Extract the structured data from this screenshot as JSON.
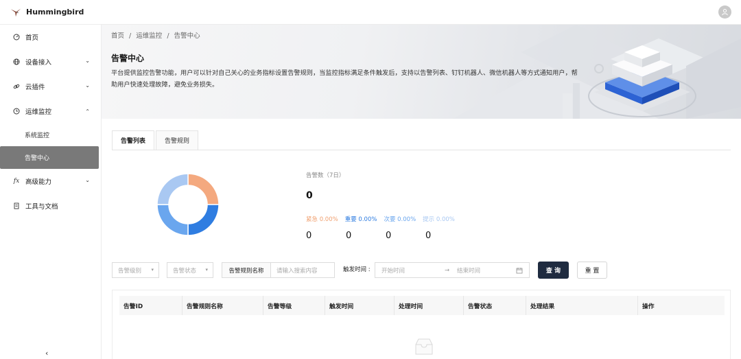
{
  "app": {
    "title": "Hummingbird"
  },
  "sidebar": {
    "items": [
      {
        "label": "首页",
        "icon": "dashboard-icon"
      },
      {
        "label": "设备接入",
        "icon": "globe-icon",
        "expandable": true
      },
      {
        "label": "云插件",
        "icon": "link-icon",
        "expandable": true
      },
      {
        "label": "运维监控",
        "icon": "clock-icon",
        "expanded": true,
        "children": [
          {
            "label": "系统监控"
          },
          {
            "label": "告警中心",
            "active": true
          }
        ]
      },
      {
        "label": "高级能力",
        "icon": "fx-icon",
        "expandable": true
      },
      {
        "label": "工具与文档",
        "icon": "doc-icon"
      }
    ]
  },
  "breadcrumb": [
    "首页",
    "/",
    "运维监控",
    "/",
    "告警中心"
  ],
  "page": {
    "title": "告警中心",
    "description": "平台提供监控告警功能，用户可以针对自己关心的业务指标设置告警规则，当监控指标满足条件触发后，支持以告警列表、钉钉机器人、微信机器人等方式通知用户，帮助用户快速处理故障，避免业务损失。"
  },
  "tabs": [
    {
      "label": "告警列表",
      "active": true
    },
    {
      "label": "告警规则"
    }
  ],
  "stats": {
    "label": "告警数（7日）",
    "total": "0",
    "levels": [
      {
        "name": "紧急 0.00%",
        "color": "#f0a070",
        "count": "0"
      },
      {
        "name": "重要 0.00%",
        "color": "#2f7de1",
        "count": "0"
      },
      {
        "name": "次要 0.00%",
        "color": "#6aa6ee",
        "count": "0"
      },
      {
        "name": "提示 0.00%",
        "color": "#a9c8f2",
        "count": "0"
      }
    ]
  },
  "donut": {
    "segments": [
      {
        "value": 25,
        "color": "#f4a97f"
      },
      {
        "value": 25,
        "color": "#2f7de1"
      },
      {
        "value": 25,
        "color": "#6aa6ee"
      },
      {
        "value": 25,
        "color": "#a9c8f2"
      }
    ]
  },
  "filters": {
    "level_placeholder": "告警级别",
    "status_placeholder": "告警状态",
    "rule_name_label": "告警规则名称",
    "search_placeholder": "请输入搜索内容",
    "time_label": "触发时间 :",
    "start_placeholder": "开始时间",
    "end_placeholder": "结束时间",
    "query_label": "查 询",
    "reset_label": "重 置"
  },
  "table": {
    "columns": [
      "告警ID",
      "告警规则名称",
      "告警等级",
      "触发时间",
      "处理时间",
      "告警状态",
      "处理结果",
      "操作"
    ]
  }
}
